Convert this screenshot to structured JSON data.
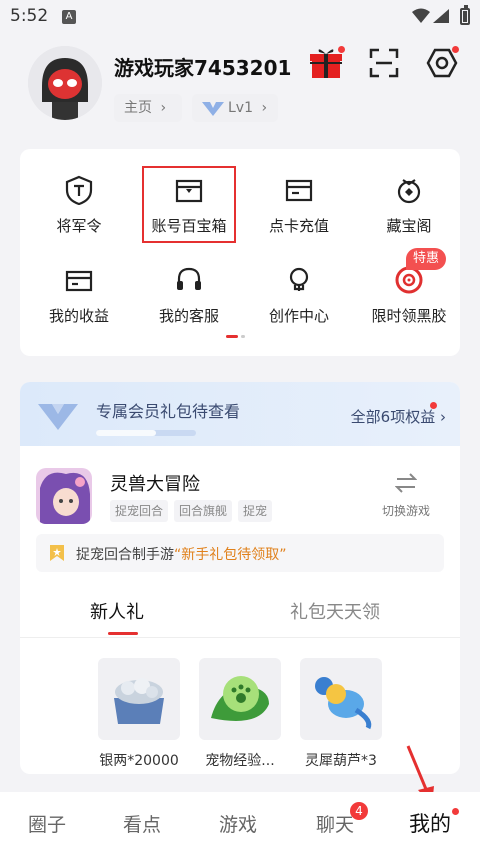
{
  "status_bar": {
    "time": "5:52",
    "notification_icon_letter": "A"
  },
  "header": {
    "username": "游戏玩家7453201",
    "home_pill": "主页",
    "level_pill": "Lv1",
    "icons": [
      "gift-icon",
      "scan-icon",
      "settings-icon"
    ]
  },
  "grid": {
    "items": [
      {
        "label": "将军令",
        "icon": "shield-t-icon"
      },
      {
        "label": "账号百宝箱",
        "icon": "treasure-box-icon"
      },
      {
        "label": "点卡充值",
        "icon": "card-icon"
      },
      {
        "label": "藏宝阁",
        "icon": "treasure-bag-icon"
      },
      {
        "label": "我的收益",
        "icon": "wallet-icon"
      },
      {
        "label": "我的客服",
        "icon": "headset-icon"
      },
      {
        "label": "创作中心",
        "icon": "bulb-icon"
      },
      {
        "label": "限时领黑胶",
        "icon": "music-disc-icon"
      }
    ],
    "special_badge": "特惠"
  },
  "vip": {
    "title": "专属会员礼包待查看",
    "all_rights": "全部6项权益"
  },
  "game": {
    "name": "灵兽大冒险",
    "tags": [
      "捉宠回合",
      "回合旗舰",
      "捉宠"
    ],
    "switch_label": "切换游戏",
    "notice_prefix": "捉宠回合制手游",
    "notice_highlight": "“新手礼包待领取”"
  },
  "tabs": {
    "active": "新人礼",
    "inactive": "礼包天天领"
  },
  "gifts": [
    {
      "name": "银两*20000"
    },
    {
      "name": "宠物经验..."
    },
    {
      "name": "灵犀葫芦*3"
    }
  ],
  "bottom_nav": {
    "items": [
      "圈子",
      "看点",
      "游戏",
      "聊天",
      "我的"
    ],
    "chat_badge": "4"
  },
  "colors": {
    "accent_red": "#e53030",
    "page_bg": "#f3f3f6",
    "vip_text": "#3a4a70"
  }
}
